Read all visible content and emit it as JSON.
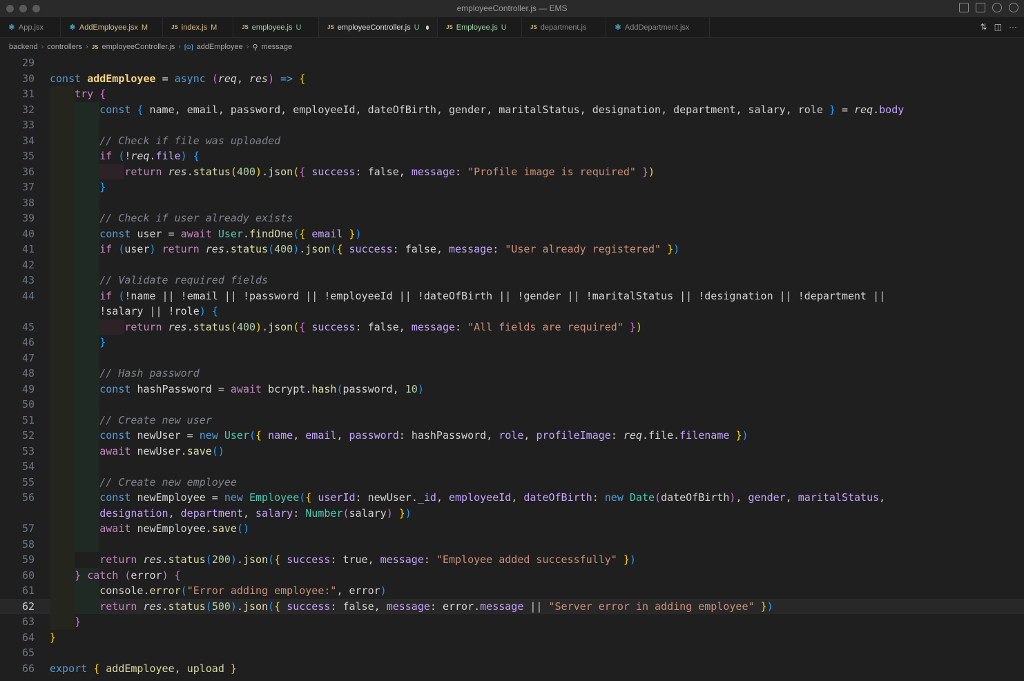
{
  "window": {
    "title": "employeeController.js — EMS"
  },
  "tabs": [
    {
      "label": "App.jsx",
      "icon": "react",
      "status": "",
      "active": false,
      "type": "plain"
    },
    {
      "label": "AddEmployee.jsx",
      "icon": "react",
      "status": "M",
      "active": false,
      "type": "m-file"
    },
    {
      "label": "index.js",
      "icon": "js",
      "status": "M",
      "active": false,
      "type": "m-file"
    },
    {
      "label": "employee.js",
      "icon": "js",
      "status": "U",
      "active": false,
      "type": "u-file"
    },
    {
      "label": "employeeController.js",
      "icon": "js",
      "status": "U",
      "active": true,
      "type": "active"
    },
    {
      "label": "Employee.js",
      "icon": "js",
      "status": "U",
      "active": false,
      "type": "u-file"
    },
    {
      "label": "department.js",
      "icon": "js",
      "status": "",
      "active": false,
      "type": "plain"
    },
    {
      "label": "AddDepartment.jsx",
      "icon": "react",
      "status": "",
      "active": false,
      "type": "plain"
    }
  ],
  "breadcrumb": {
    "folder1": "backend",
    "folder2": "controllers",
    "file": "employeeController.js",
    "symbol": "addEmployee",
    "member": "message"
  },
  "editor": {
    "current_line": 62,
    "lines": [
      {
        "n": "29",
        "html": ""
      },
      {
        "n": "30",
        "html": "<span class='kw'>const</span> <span class='fnb'>addEmployee</span> <span class='op'>=</span> <span class='kw'>async</span> <span class='b2'>(</span><span class='var it'>req</span>, <span class='var it'>res</span><span class='b2'>)</span> <span class='kw'>=&gt;</span> <span class='b1'>{</span>"
      },
      {
        "n": "31",
        "html": "    <span class='kc'>try</span> <span class='b2'>{</span>"
      },
      {
        "n": "32",
        "html": "        <span class='kw'>const</span> <span class='b3'>{</span> <span class='var'>name</span>, <span class='var'>email</span>, <span class='var'>password</span>, <span class='var'>employeeId</span>, <span class='var'>dateOfBirth</span>, <span class='var'>gender</span>, <span class='var'>maritalStatus</span>, <span class='var'>designation</span>, <span class='var'>department</span>, <span class='var'>salary</span>, <span class='var'>role</span> <span class='b3'>}</span> = <span class='var it'>req</span>.<span class='key'>body</span>"
      },
      {
        "n": "33",
        "html": ""
      },
      {
        "n": "34",
        "html": "        <span class='cm'>// Check if file was uploaded</span>"
      },
      {
        "n": "35",
        "html": "        <span class='kc'>if</span> <span class='b3'>(</span>!<span class='var it'>req</span>.<span class='key'>file</span><span class='b3'>)</span> <span class='b3'>{</span>"
      },
      {
        "n": "36",
        "html": "            <span class='kc'>return</span> <span class='var it'>res</span>.<span class='fn'>status</span><span class='b1'>(</span><span class='num'>400</span><span class='b1'>)</span>.<span class='fn'>json</span><span class='b1'>(</span><span class='b2'>{</span> <span class='key'>success</span>: <span class='var'>false</span>, <span class='key'>message</span>: <span class='str'>\"Profile image is required\"</span> <span class='b2'>}</span><span class='b1'>)</span>"
      },
      {
        "n": "37",
        "html": "        <span class='b3'>}</span>"
      },
      {
        "n": "38",
        "html": ""
      },
      {
        "n": "39",
        "html": "        <span class='cm'>// Check if user already exists</span>"
      },
      {
        "n": "40",
        "html": "        <span class='kw'>const</span> <span class='var'>user</span> = <span class='kc'>await</span> <span class='cls'>User</span>.<span class='fn'>findOne</span><span class='b3'>(</span><span class='b1'>{</span> <span class='key'>email</span> <span class='b1'>}</span><span class='b3'>)</span>"
      },
      {
        "n": "41",
        "html": "        <span class='kc'>if</span> <span class='b3'>(</span><span class='var'>user</span><span class='b3'>)</span> <span class='kc'>return</span> <span class='var it'>res</span>.<span class='fn'>status</span><span class='b3'>(</span><span class='num'>400</span><span class='b3'>)</span>.<span class='fn'>json</span><span class='b3'>(</span><span class='b1'>{</span> <span class='key'>success</span>: <span class='var'>false</span>, <span class='key'>message</span>: <span class='str'>\"User already registered\"</span> <span class='b1'>}</span><span class='b3'>)</span>"
      },
      {
        "n": "42",
        "html": ""
      },
      {
        "n": "43",
        "html": "        <span class='cm'>// Validate required fields</span>"
      },
      {
        "n": "44",
        "html": "        <span class='kc'>if</span> <span class='b3'>(</span>!<span class='var'>name</span> || !<span class='var'>email</span> || !<span class='var'>password</span> || !<span class='var'>employeeId</span> || !<span class='var'>dateOfBirth</span> || !<span class='var'>gender</span> || !<span class='var'>maritalStatus</span> || !<span class='var'>designation</span> || !<span class='var'>department</span> ||"
      },
      {
        "n": "",
        "html": "        !<span class='var'>salary</span> || !<span class='var'>role</span><span class='b3'>)</span> <span class='b3'>{</span>",
        "wrap": true
      },
      {
        "n": "45",
        "html": "            <span class='kc'>return</span> <span class='var it'>res</span>.<span class='fn'>status</span><span class='b1'>(</span><span class='num'>400</span><span class='b1'>)</span>.<span class='fn'>json</span><span class='b1'>(</span><span class='b2'>{</span> <span class='key'>success</span>: <span class='var'>false</span>, <span class='key'>message</span>: <span class='str'>\"All fields are required\"</span> <span class='b2'>}</span><span class='b1'>)</span>"
      },
      {
        "n": "46",
        "html": "        <span class='b3'>}</span>"
      },
      {
        "n": "47",
        "html": ""
      },
      {
        "n": "48",
        "html": "        <span class='cm'>// Hash password</span>"
      },
      {
        "n": "49",
        "html": "        <span class='kw'>const</span> <span class='var'>hashPassword</span> = <span class='kc'>await</span> <span class='var'>bcrypt</span>.<span class='fn'>hash</span><span class='b3'>(</span><span class='var'>password</span>, <span class='num'>10</span><span class='b3'>)</span>"
      },
      {
        "n": "50",
        "html": ""
      },
      {
        "n": "51",
        "html": "        <span class='cm'>// Create new user</span>"
      },
      {
        "n": "52",
        "html": "        <span class='kw'>const</span> <span class='var'>newUser</span> = <span class='kw'>new</span> <span class='cls'>User</span><span class='b3'>(</span><span class='b1'>{</span> <span class='key'>name</span>, <span class='key'>email</span>, <span class='key'>password</span>: <span class='var'>hashPassword</span>, <span class='key'>role</span>, <span class='key'>profileImage</span>: <span class='var it'>req</span>.<span class='var'>file</span>.<span class='key'>filename</span> <span class='b1'>}</span><span class='b3'>)</span>"
      },
      {
        "n": "53",
        "html": "        <span class='kc'>await</span> <span class='var'>newUser</span>.<span class='fn'>save</span><span class='b3'>()</span>"
      },
      {
        "n": "54",
        "html": ""
      },
      {
        "n": "55",
        "html": "        <span class='cm'>// Create new employee</span>"
      },
      {
        "n": "56",
        "html": "        <span class='kw'>const</span> <span class='var'>newEmployee</span> = <span class='kw'>new</span> <span class='cls'>Employee</span><span class='b3'>(</span><span class='b1'>{</span> <span class='key'>userId</span>: <span class='var'>newUser</span>.<span class='key'>_id</span>, <span class='key'>employeeId</span>, <span class='key'>dateOfBirth</span>: <span class='kw'>new</span> <span class='cls'>Date</span><span class='b2'>(</span><span class='var'>dateOfBirth</span><span class='b2'>)</span>, <span class='key'>gender</span>, <span class='key'>maritalStatus</span>,"
      },
      {
        "n": "",
        "html": "        <span class='key'>designation</span>, <span class='key'>department</span>, <span class='key'>salary</span>: <span class='cls'>Number</span><span class='b2'>(</span><span class='var'>salary</span><span class='b2'>)</span> <span class='b1'>}</span><span class='b3'>)</span>",
        "wrap": true
      },
      {
        "n": "57",
        "html": "        <span class='kc'>await</span> <span class='var'>newEmployee</span>.<span class='fn'>save</span><span class='b3'>()</span>"
      },
      {
        "n": "58",
        "html": ""
      },
      {
        "n": "59",
        "html": "        <span class='kc'>return</span> <span class='var it'>res</span>.<span class='fn'>status</span><span class='b3'>(</span><span class='num'>200</span><span class='b3'>)</span>.<span class='fn'>json</span><span class='b3'>(</span><span class='b1'>{</span> <span class='key'>success</span>: <span class='var'>true</span>, <span class='key'>message</span>: <span class='str'>\"Employee added successfully\"</span> <span class='b1'>}</span><span class='b3'>)</span>"
      },
      {
        "n": "60",
        "html": "    <span class='b2'>}</span> <span class='kc'>catch</span> <span class='b2'>(</span><span class='var'>error</span><span class='b2'>)</span> <span class='b2'>{</span>"
      },
      {
        "n": "61",
        "html": "        <span class='var'>console</span>.<span class='fn'>error</span><span class='b3'>(</span><span class='str'>\"Error adding employee:\"</span>, <span class='var'>error</span><span class='b3'>)</span>"
      },
      {
        "n": "62",
        "html": "        <span class='kc'>return</span> <span class='var it'>res</span>.<span class='fn'>status</span><span class='b3'>(</span><span class='num'>500</span><span class='b3'>)</span>.<span class='fn'>json</span><span class='b3'>(</span><span class='b1'>{</span> <span class='key'>success</span>: <span class='var'>false</span>, <span class='key'>message</span>: <span class='var'>error</span>.<span class='key'>message</span> || <span class='str'>\"Server error in adding employee\"</span> <span class='b1'>}</span><span class='b3'>)</span>"
      },
      {
        "n": "63",
        "html": "    <span class='b2'>}</span>"
      },
      {
        "n": "64",
        "html": "<span class='b1'>}</span>"
      },
      {
        "n": "65",
        "html": ""
      },
      {
        "n": "66",
        "html": "<span class='kw'>export</span> <span class='b1'>{</span> <span class='fn'>addEmployee</span>, <span class='fn'>upload</span> <span class='b1'>}</span>"
      }
    ]
  }
}
